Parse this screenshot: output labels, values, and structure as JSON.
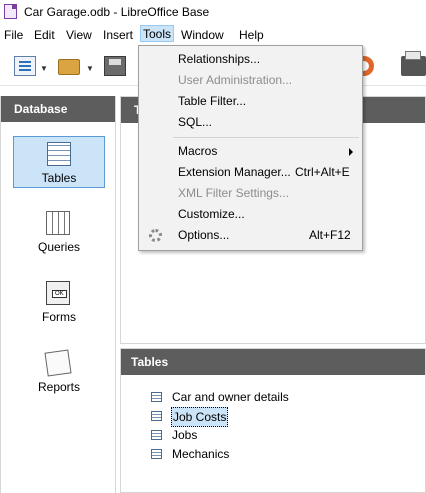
{
  "window": {
    "title": "Car Garage.odb - LibreOffice Base"
  },
  "menubar": [
    {
      "label": "File",
      "active": false
    },
    {
      "label": "Edit",
      "active": false
    },
    {
      "label": "View",
      "active": false
    },
    {
      "label": "Insert",
      "active": false
    },
    {
      "label": "Tools",
      "active": true
    },
    {
      "label": "Window",
      "active": false
    },
    {
      "label": "Help",
      "active": false
    }
  ],
  "toolbar": {
    "icons": [
      "new-document-icon",
      "open-folder-icon",
      "save-icon",
      "help-lifebuoy-icon",
      "printer-icon"
    ]
  },
  "tools_menu": {
    "items": [
      {
        "label": "Relationships...",
        "shortcut": "",
        "enabled": true
      },
      {
        "label": "User Administration...",
        "shortcut": "",
        "enabled": false
      },
      {
        "label": "Table Filter...",
        "shortcut": "",
        "enabled": true
      },
      {
        "label": "SQL...",
        "shortcut": "",
        "enabled": true
      },
      {
        "label": "Macros",
        "shortcut": "",
        "enabled": true,
        "submenu": true
      },
      {
        "label": "Extension Manager...",
        "shortcut": "Ctrl+Alt+E",
        "enabled": true
      },
      {
        "label": "XML Filter Settings...",
        "shortcut": "",
        "enabled": false
      },
      {
        "label": "Customize...",
        "shortcut": "",
        "enabled": true
      },
      {
        "label": "Options...",
        "shortcut": "Alt+F12",
        "enabled": true,
        "icon": "gear-icon"
      }
    ]
  },
  "database_panel": {
    "header": "Database",
    "items": [
      {
        "label": "Tables",
        "icon": "table-icon",
        "selected": true
      },
      {
        "label": "Queries",
        "icon": "query-icon",
        "selected": false
      },
      {
        "label": "Forms",
        "icon": "form-icon",
        "selected": false
      },
      {
        "label": "Reports",
        "icon": "report-icon",
        "selected": false
      }
    ]
  },
  "tasks_panel": {
    "header": "T"
  },
  "tables_panel": {
    "header": "Tables",
    "rows": [
      {
        "name": "Car and owner details",
        "selected": false
      },
      {
        "name": "Job Costs",
        "selected": true
      },
      {
        "name": "Jobs",
        "selected": false
      },
      {
        "name": "Mechanics",
        "selected": false
      }
    ]
  }
}
